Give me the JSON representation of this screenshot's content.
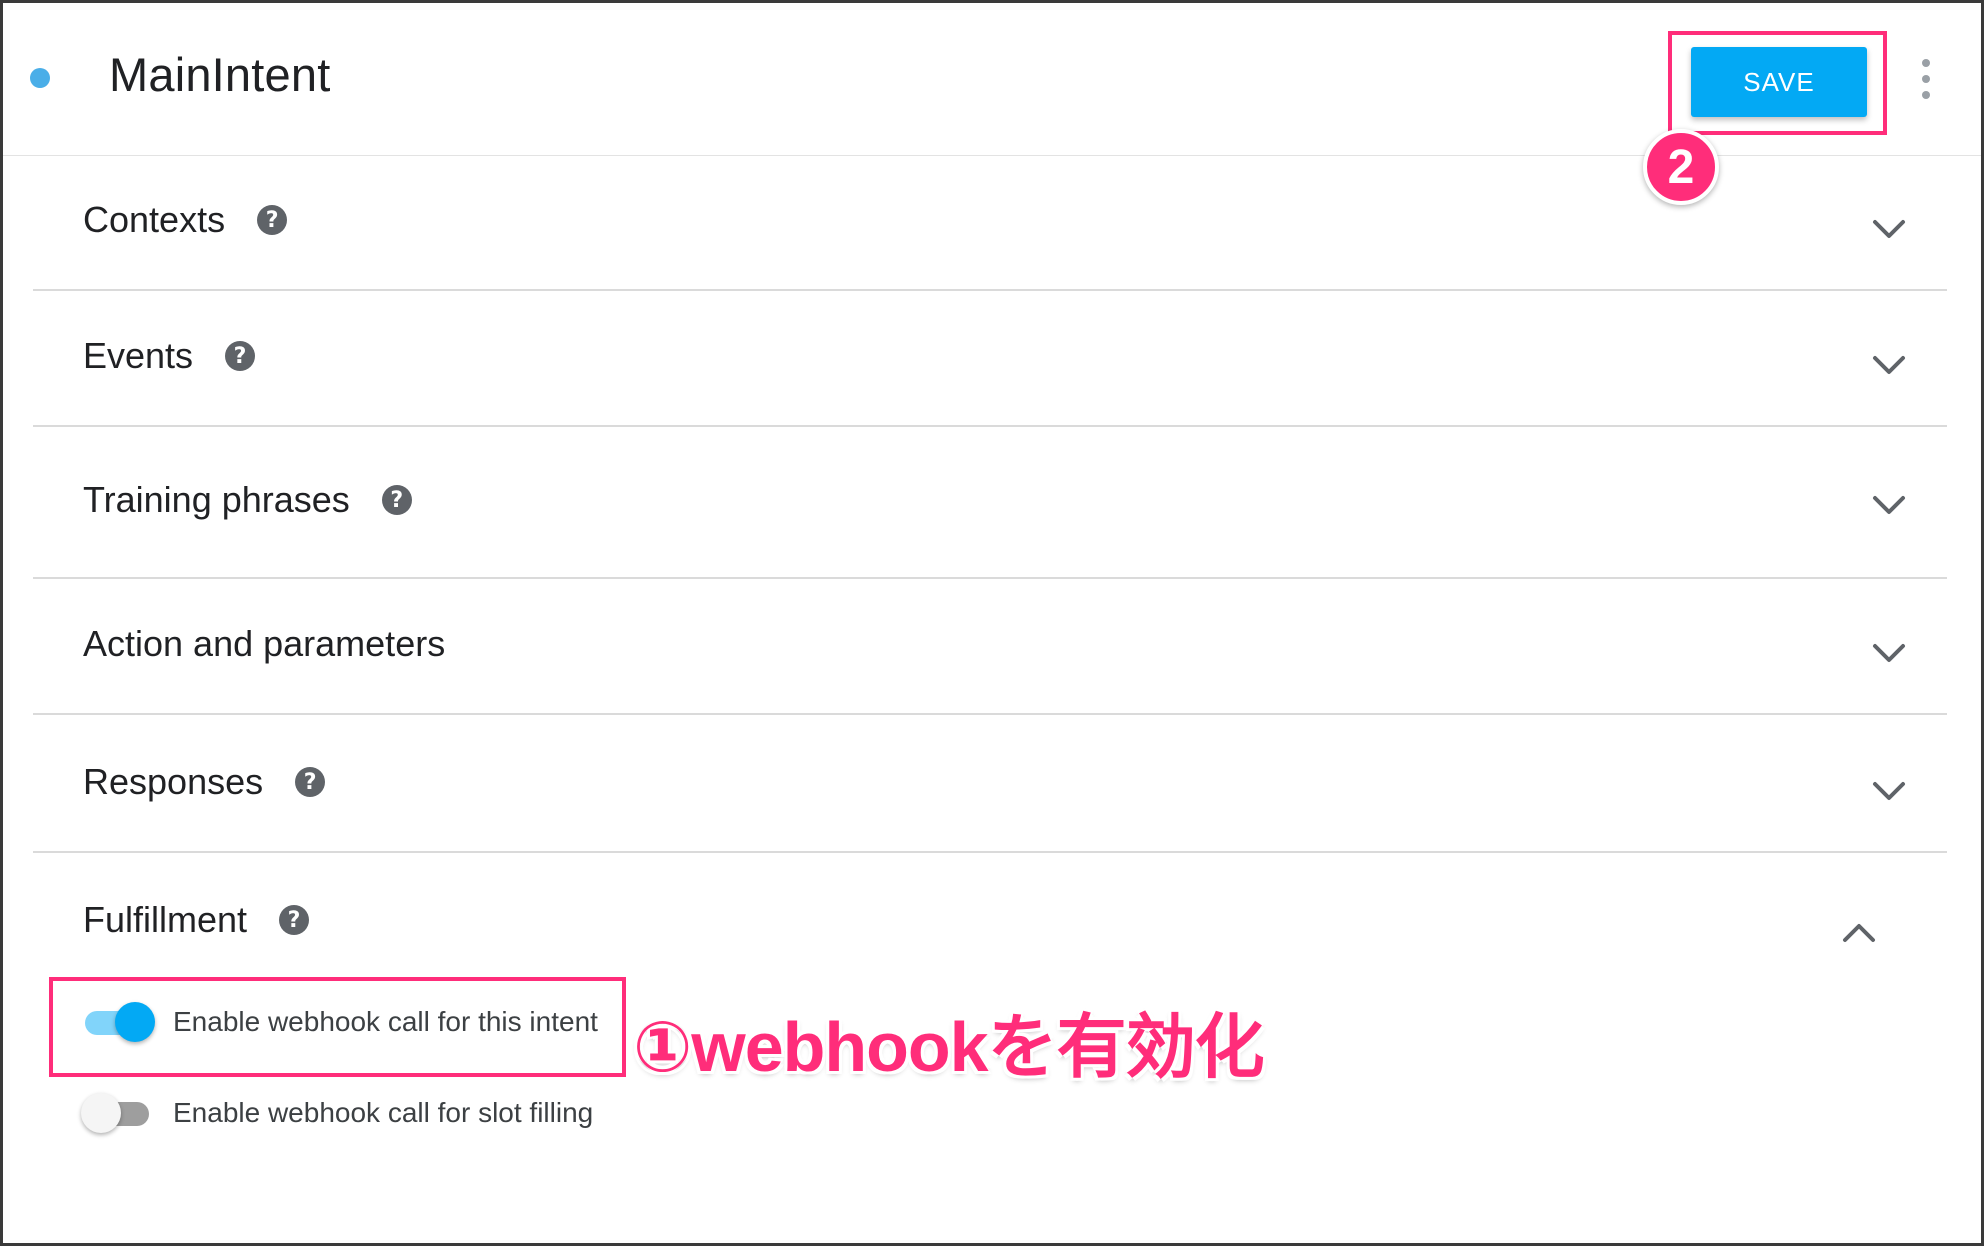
{
  "header": {
    "title": "MainIntent",
    "save_label": "SAVE"
  },
  "sections": [
    {
      "label": "Contexts",
      "help": "?",
      "expanded": false
    },
    {
      "label": "Events",
      "help": "?",
      "expanded": false
    },
    {
      "label": "Training phrases",
      "help": "?",
      "expanded": false
    },
    {
      "label": "Action and parameters",
      "expanded": false
    },
    {
      "label": "Responses",
      "help": "?",
      "expanded": false
    },
    {
      "label": "Fulfillment",
      "help": "?",
      "expanded": true
    }
  ],
  "fulfillment": {
    "webhook_intent_label": "Enable webhook call for this intent",
    "webhook_intent_enabled": true,
    "webhook_slot_label": "Enable webhook call for slot filling",
    "webhook_slot_enabled": false
  },
  "annotations": {
    "step1_text": "①webhookを有効化",
    "step2_marker": "2"
  },
  "colors": {
    "accent": "#03a9f4",
    "annotation": "#ff2d7a",
    "status_dot": "#4aaee8"
  }
}
